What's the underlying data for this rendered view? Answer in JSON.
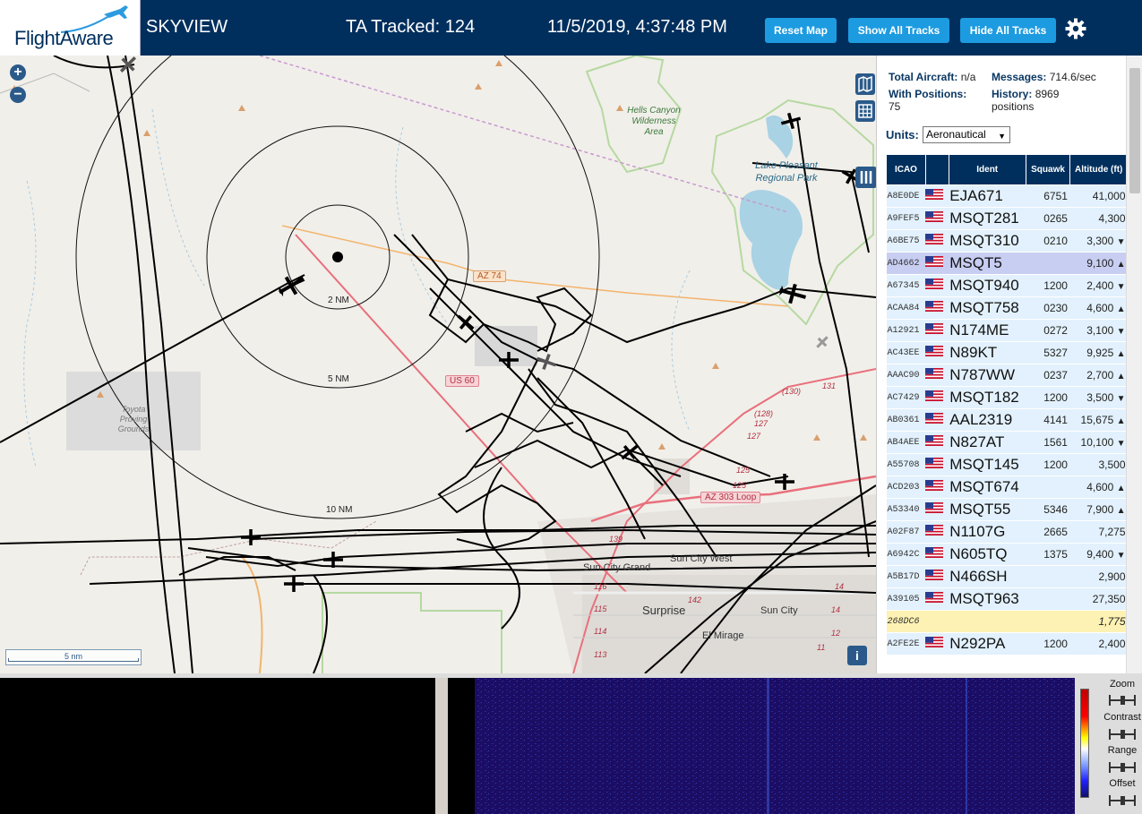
{
  "header": {
    "logo_text": "FlightAware",
    "app_name": "SKYVIEW",
    "tracked": "TA Tracked: 124",
    "datetime": "11/5/2019, 4:37:48 PM",
    "reset_map": "Reset Map",
    "show_all": "Show All Tracks",
    "hide_all": "Hide All Tracks",
    "settings_icon": "gear-icon"
  },
  "map": {
    "zoom_in": "+",
    "zoom_out": "−",
    "scale_label": "5 nm",
    "info": "i",
    "range_labels": [
      "2 NM",
      "5 NM",
      "10 NM"
    ],
    "road_labels": [
      "AZ 74",
      "US 60",
      "AZ 303 Loop"
    ],
    "place_labels": [
      "Hells Canyon Wilderness Area",
      "Lake Pleasant Regional Park",
      "Toyota Proving Grounds",
      "Sun City Grand",
      "Sun City West",
      "Surprise",
      "Sun City",
      "El Mirage"
    ],
    "route_labels": [
      "(130)",
      "131",
      "(128)",
      "127",
      "127",
      "125",
      "125",
      "139",
      "116",
      "115",
      "114",
      "113",
      "142",
      "14",
      "14",
      "12",
      "11"
    ],
    "road_colors": {
      "highway": "#e8707c",
      "arterial": "#f2b46c",
      "boundary": "#b5d9a1",
      "water": "#a9d2e4"
    }
  },
  "sidebar": {
    "total_aircraft_label": "Total Aircraft:",
    "total_aircraft_value": "n/a",
    "messages_label": "Messages:",
    "messages_value": "714.6/sec",
    "positions_label": "With Positions:",
    "positions_value": "75",
    "history_label": "History:",
    "history_value": "8969",
    "history_unit": "positions",
    "units_label": "Units:",
    "units_value": "Aeronautical",
    "columns": [
      "ICAO",
      "",
      "Ident",
      "Squawk",
      "Altitude (ft)"
    ],
    "rows": [
      {
        "icao": "A8E0DE",
        "ident": "EJA671",
        "squawk": "6751",
        "alt": "41,000",
        "trend": ""
      },
      {
        "icao": "A9FEF5",
        "ident": "MSQT281",
        "squawk": "0265",
        "alt": "4,300",
        "trend": ""
      },
      {
        "icao": "A6BE75",
        "ident": "MSQT310",
        "squawk": "0210",
        "alt": "3,300",
        "trend": "▼"
      },
      {
        "icao": "AD4662",
        "ident": "MSQT5",
        "squawk": "",
        "alt": "9,100",
        "trend": "▲",
        "selected": true
      },
      {
        "icao": "A67345",
        "ident": "MSQT940",
        "squawk": "1200",
        "alt": "2,400",
        "trend": "▼"
      },
      {
        "icao": "ACAA84",
        "ident": "MSQT758",
        "squawk": "0230",
        "alt": "4,600",
        "trend": "▲"
      },
      {
        "icao": "A12921",
        "ident": "N174ME",
        "squawk": "0272",
        "alt": "3,100",
        "trend": "▼"
      },
      {
        "icao": "AC43EE",
        "ident": "N89KT",
        "squawk": "5327",
        "alt": "9,925",
        "trend": "▲"
      },
      {
        "icao": "AAAC90",
        "ident": "N787WW",
        "squawk": "0237",
        "alt": "2,700",
        "trend": "▲"
      },
      {
        "icao": "AC7429",
        "ident": "MSQT182",
        "squawk": "1200",
        "alt": "3,500",
        "trend": "▼"
      },
      {
        "icao": "AB0361",
        "ident": "AAL2319",
        "squawk": "4141",
        "alt": "15,675",
        "trend": "▲"
      },
      {
        "icao": "AB4AEE",
        "ident": "N827AT",
        "squawk": "1561",
        "alt": "10,100",
        "trend": "▼"
      },
      {
        "icao": "A55708",
        "ident": "MSQT145",
        "squawk": "1200",
        "alt": "3,500",
        "trend": ""
      },
      {
        "icao": "ACD203",
        "ident": "MSQT674",
        "squawk": "",
        "alt": "4,600",
        "trend": "▲"
      },
      {
        "icao": "A53340",
        "ident": "MSQT55",
        "squawk": "5346",
        "alt": "7,900",
        "trend": "▲"
      },
      {
        "icao": "A02F87",
        "ident": "N1107G",
        "squawk": "2665",
        "alt": "7,275",
        "trend": ""
      },
      {
        "icao": "A6942C",
        "ident": "N605TQ",
        "squawk": "1375",
        "alt": "9,400",
        "trend": "▼"
      },
      {
        "icao": "A5B17D",
        "ident": "N466SH",
        "squawk": "",
        "alt": "2,900",
        "trend": ""
      },
      {
        "icao": "A39105",
        "ident": "MSQT963",
        "squawk": "",
        "alt": "27,350",
        "trend": ""
      },
      {
        "icao": "268DC6",
        "ident": "",
        "squawk": "",
        "alt": "1,775",
        "trend": "",
        "yellow": true
      },
      {
        "icao": "A2FE2E",
        "ident": "N292PA",
        "squawk": "1200",
        "alt": "2,400",
        "trend": ""
      }
    ]
  },
  "spectrum": {
    "controls": [
      "Zoom",
      "Contrast",
      "Range",
      "Offset"
    ]
  }
}
